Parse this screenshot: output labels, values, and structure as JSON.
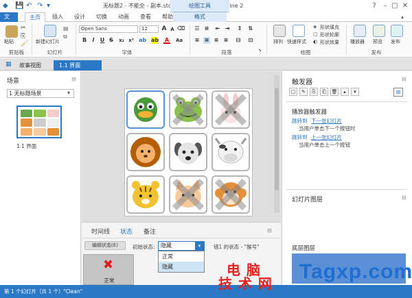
{
  "titlebar": {
    "title": "无标题2 - 不能全 - 副本.story* - Articulate Storyline 2",
    "tool_context": "绘图工具"
  },
  "ribbon_tabs": [
    "文件",
    "主页",
    "插入",
    "设计",
    "切换",
    "动画",
    "查看",
    "帮助",
    "格式"
  ],
  "ribbon": {
    "clipboard": {
      "paste": "粘贴",
      "label": "剪贴板"
    },
    "slides": {
      "new_slide": "新建幻灯片",
      "label": "幻灯片"
    },
    "font": {
      "family": "Open Sans",
      "size": "12",
      "label": "字体"
    },
    "paragraph": {
      "label": "段落"
    },
    "drawing": {
      "arrange": "排列",
      "quick_styles": "快速样式",
      "fill": "形状填充",
      "outline": "形状轮廓",
      "effects": "形状效果",
      "label": "绘图"
    },
    "publish": {
      "player": "播放器",
      "preview": "预览",
      "publish": "发布",
      "label": "发布"
    }
  },
  "viewtabs": [
    "故事视图",
    "1.1 界面"
  ],
  "scenes": {
    "title": "场景",
    "selected_scene": "1 无标题场景",
    "slide_label": "1.1 界面"
  },
  "statespanel": {
    "tabs": [
      "时间线",
      "状态",
      "备注"
    ],
    "edit_button": "编辑状态(E)",
    "initial_state_label": "初始状态:",
    "initial_state_value": "隐藏",
    "options": [
      "正常",
      "隐藏"
    ],
    "state_info": "错1 的状态 - \"猴号\"",
    "state_thumb_label": "正常"
  },
  "triggers": {
    "title": "触发器",
    "section": "播放器触发器",
    "items": [
      {
        "action": "跳转到",
        "target": "下一张幻灯片",
        "when": "当用户单击下一个按钮时"
      },
      {
        "action": "跳转到",
        "target": "上一张幻灯片",
        "when": "当用户单击上一个按钮"
      }
    ]
  },
  "layers": {
    "title": "幻灯片图层",
    "base_layer": "底层图层"
  },
  "statusbar": {
    "slide_info": "第 1 个幻灯片（共 1 个）",
    "theme": "\"Clean\""
  },
  "watermark": {
    "line1": "电 脑",
    "line2": "技 术 网",
    "site": "Tagxp.com"
  },
  "colors": {
    "accent": "#2b78c6",
    "watermark_red": "#e32222",
    "watermark_blue": "#1e6fd0"
  }
}
